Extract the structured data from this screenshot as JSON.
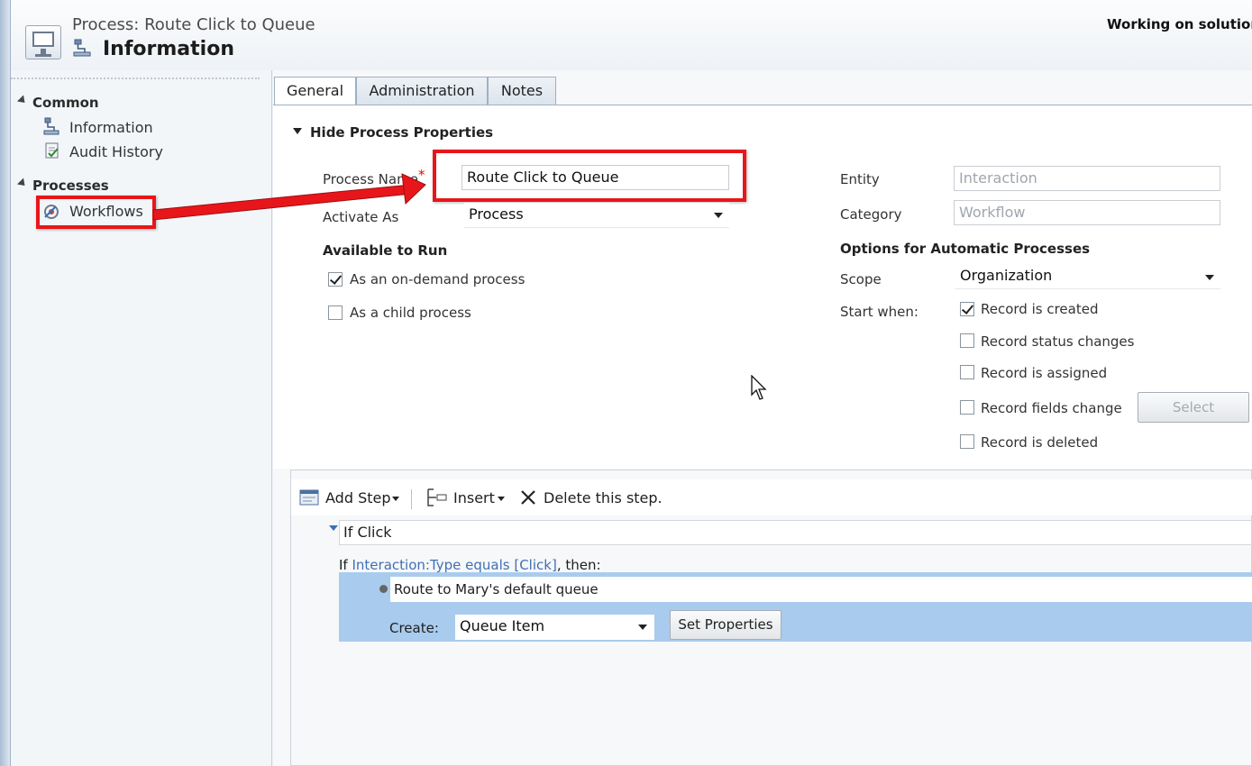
{
  "header": {
    "subtitle": "Process: Route Click to Queue",
    "title": "Information",
    "solution_text": "Working on solution:"
  },
  "nav": {
    "sections": [
      {
        "label": "Common",
        "items": [
          {
            "label": "Information",
            "icon": "process-icon"
          },
          {
            "label": "Audit History",
            "icon": "audit-icon"
          }
        ]
      },
      {
        "label": "Processes",
        "items": [
          {
            "label": "Workflows",
            "icon": "workflow-icon"
          }
        ]
      }
    ]
  },
  "tabs": [
    {
      "label": "General",
      "active": true
    },
    {
      "label": "Administration",
      "active": false
    },
    {
      "label": "Notes",
      "active": false
    }
  ],
  "form": {
    "section_title": "Hide Process Properties",
    "process_name_label": "Process Name",
    "required_mark": "*",
    "process_name_value": "Route Click to Queue",
    "activate_as_label": "Activate As",
    "activate_as_value": "Process",
    "available_to_run_label": "Available to Run",
    "on_demand_label": "As an on-demand process",
    "on_demand_checked": true,
    "child_process_label": "As a child process",
    "child_process_checked": false,
    "entity_label": "Entity",
    "entity_value": "Interaction",
    "category_label": "Category",
    "category_value": "Workflow",
    "auto_options_label": "Options for Automatic Processes",
    "scope_label": "Scope",
    "scope_value": "Organization",
    "start_when_label": "Start when:",
    "start_when": [
      {
        "label": "Record is created",
        "checked": true
      },
      {
        "label": "Record status changes",
        "checked": false
      },
      {
        "label": "Record is assigned",
        "checked": false
      },
      {
        "label": "Record fields change",
        "checked": false
      },
      {
        "label": "Record is deleted",
        "checked": false
      }
    ],
    "select_button": "Select"
  },
  "steps": {
    "toolbar": {
      "add_step": "Add Step",
      "insert": "Insert",
      "delete": "Delete this step."
    },
    "if_step_name": "If Click",
    "condition_prefix": "If",
    "condition_link": "Interaction:Type equals [Click]",
    "condition_suffix": ", then:",
    "action_name": "Route to Mary's default queue",
    "create_label": "Create:",
    "create_value": "Queue Item",
    "set_properties": "Set Properties"
  },
  "colors": {
    "annotation_red": "#e8161a",
    "band_blue": "#a9cbee",
    "link_blue": "#3f70b3"
  }
}
